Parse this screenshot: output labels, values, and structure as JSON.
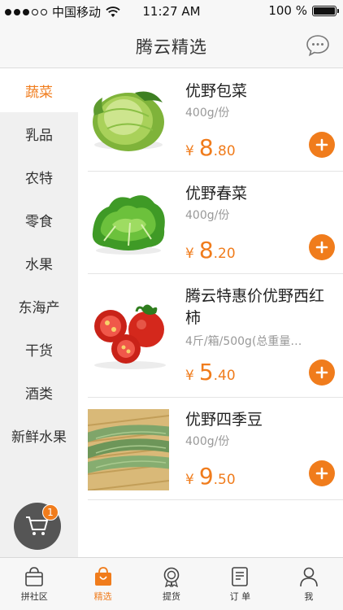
{
  "status_bar": {
    "carrier": "中国移动",
    "time": "11:27 AM",
    "battery": "100 %"
  },
  "header": {
    "title": "腾云精选"
  },
  "sidebar": {
    "items": [
      {
        "label": "蔬菜",
        "active": true
      },
      {
        "label": "乳品"
      },
      {
        "label": "农特"
      },
      {
        "label": "零食"
      },
      {
        "label": "水果"
      },
      {
        "label": "东海产"
      },
      {
        "label": "干货"
      },
      {
        "label": "酒类"
      },
      {
        "label": "新鲜水果"
      }
    ]
  },
  "cart": {
    "count": "1",
    "icon": "shopping-cart-icon"
  },
  "products": [
    {
      "name": "优野包菜",
      "spec": "400g/份",
      "currency": "¥",
      "price_int": "8",
      "price_dec": ".80",
      "image": "cabbage"
    },
    {
      "name": "优野春菜",
      "spec": "400g/份",
      "currency": "¥",
      "price_int": "8",
      "price_dec": ".20",
      "image": "lettuce"
    },
    {
      "name": "腾云特惠价优野西红柿",
      "spec": "4斤/箱/500g(总重量…",
      "currency": "¥",
      "price_int": "5",
      "price_dec": ".40",
      "image": "tomatoes"
    },
    {
      "name": "优野四季豆",
      "spec": "400g/份",
      "currency": "¥",
      "price_int": "9",
      "price_dec": ".50",
      "image": "green-beans"
    }
  ],
  "tabs": [
    {
      "label": "拼社区",
      "icon": "basket-icon"
    },
    {
      "label": "精选",
      "icon": "shopping-bag-icon",
      "active": true
    },
    {
      "label": "提货",
      "icon": "badge-icon"
    },
    {
      "label": "订 单",
      "icon": "order-icon"
    },
    {
      "label": "我",
      "icon": "user-icon"
    }
  ],
  "colors": {
    "accent": "#f07c1c",
    "sidebar_bg": "#f0f0f0",
    "cart_bg": "#555555"
  }
}
